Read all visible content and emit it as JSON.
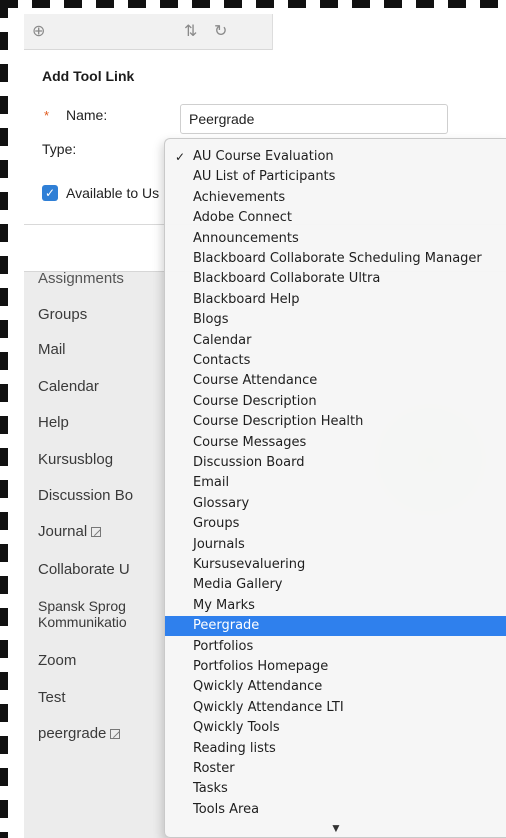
{
  "toolbar": {
    "icons": [
      "add-circle-icon",
      "sort-icon",
      "refresh-icon"
    ]
  },
  "panel": {
    "title": "Add Tool Link",
    "name_label": "Name:",
    "name_value": "Peergrade",
    "type_label": "Type:",
    "available_label": "Available to Us",
    "available_checked": true
  },
  "sidebar": {
    "items": [
      {
        "label": "Assignments"
      },
      {
        "label": "Groups"
      },
      {
        "label": "Mail"
      },
      {
        "label": "Calendar"
      },
      {
        "label": "Help"
      },
      {
        "label": "Kursusblog"
      },
      {
        "label": "Discussion Bo"
      },
      {
        "label": "Journal"
      },
      {
        "label": "Collaborate U"
      },
      {
        "label": "Spansk Sprog"
      },
      {
        "label": "Kommunikatio"
      },
      {
        "label": "Zoom"
      },
      {
        "label": "Test"
      },
      {
        "label": "peergrade"
      }
    ]
  },
  "dropdown": {
    "checked_index": 0,
    "selected_index": 23,
    "options": [
      "AU Course Evaluation",
      "AU List of Participants",
      "Achievements",
      "Adobe Connect",
      "Announcements",
      "Blackboard Collaborate Scheduling Manager",
      "Blackboard Collaborate Ultra",
      "Blackboard Help",
      "Blogs",
      "Calendar",
      "Contacts",
      "Course Attendance",
      "Course Description",
      "Course Description Health",
      "Course Messages",
      "Discussion Board",
      "Email",
      "Glossary",
      "Groups",
      "Journals",
      "Kursusevaluering",
      "Media Gallery",
      "My Marks",
      "Peergrade",
      "Portfolios",
      "Portfolios Homepage",
      "Qwickly Attendance",
      "Qwickly Attendance LTI",
      "Qwickly Tools",
      "Reading lists",
      "Roster",
      "Tasks",
      "Tools Area"
    ]
  },
  "colors": {
    "accent": "#2f80ed",
    "checkbox": "#2f7fd6",
    "required": "#e05a1d"
  }
}
